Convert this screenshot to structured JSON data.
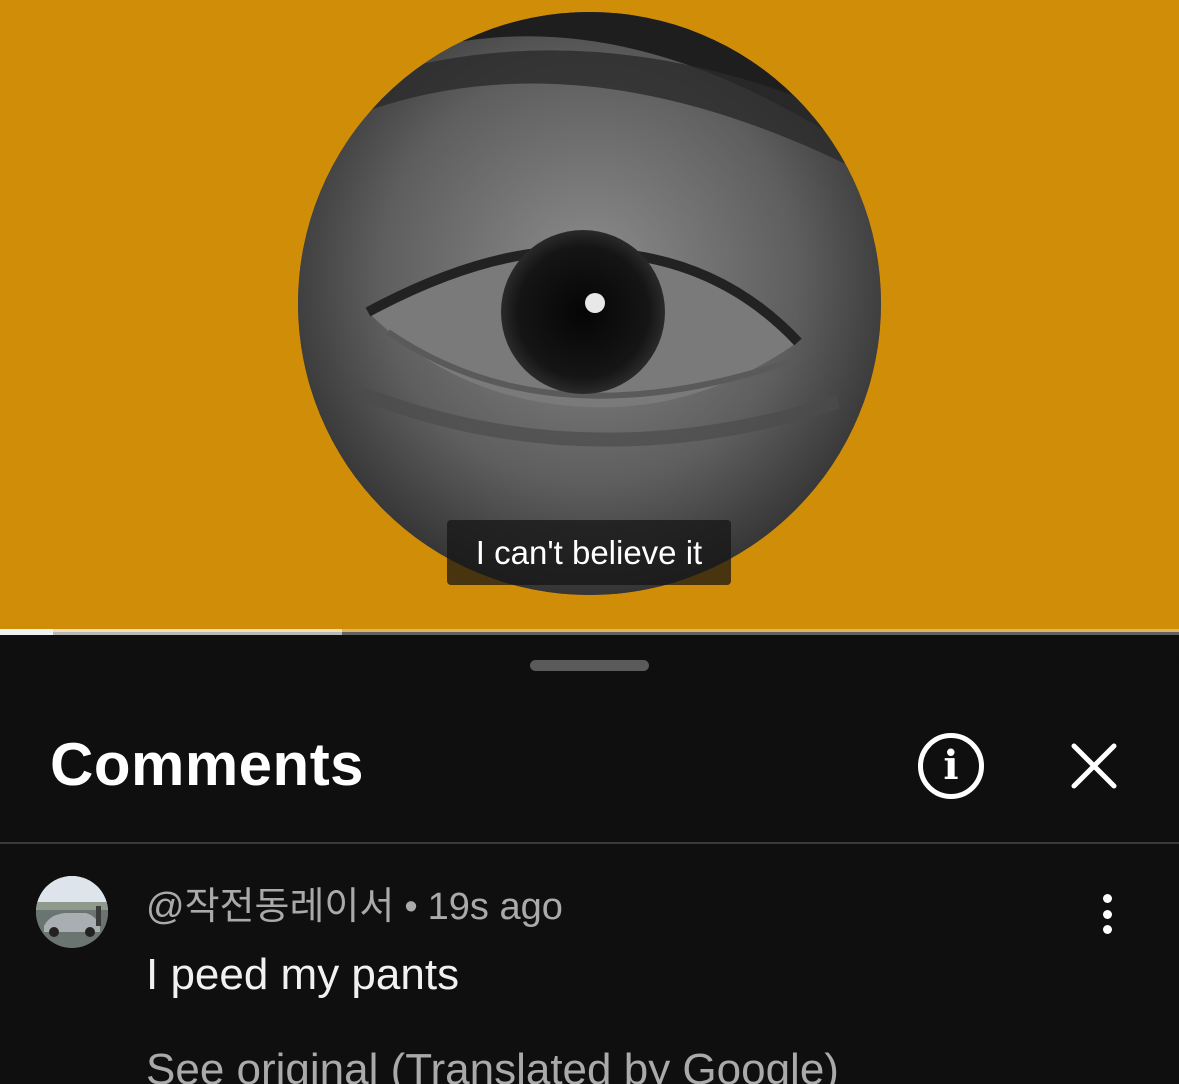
{
  "video": {
    "caption": "I can't believe it",
    "background_color": "#d08e08",
    "progress_played_fraction": 0.045,
    "progress_buffered_fraction": 0.29
  },
  "comments_panel": {
    "title": "Comments",
    "info_icon": "info-icon",
    "close_icon": "close-icon"
  },
  "comments": [
    {
      "author": "@작전동레이서",
      "separator": "•",
      "time": "19s ago",
      "text": "I peed my pants",
      "translation_link": "See original (Translated by Google)",
      "menu_icon": "more-vertical-icon"
    }
  ]
}
